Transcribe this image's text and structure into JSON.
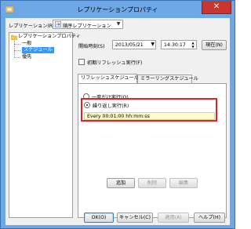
{
  "window": {
    "title": "レプリケーションプロパティ",
    "close_glyph": "✕"
  },
  "replication": {
    "label": "レプリケーション(R)",
    "selected": "順序レプリケーション"
  },
  "tree": {
    "root": "レプリケーションプロパティ",
    "items": [
      "一般",
      "スケジュール",
      "優先"
    ],
    "selected_index": 1
  },
  "schedule": {
    "start_label": "開始時刻(S)",
    "date": "2013/05/21",
    "time": "14:30:17",
    "now_button": "現在(N)",
    "initial_refresh_label": "初期リフレッシュ実行(F)",
    "initial_refresh_checked": false
  },
  "tabs": [
    {
      "label": "リフレッシュスケジュール",
      "active": true
    },
    {
      "label": "ミラーリングスケジュール",
      "active": false
    }
  ],
  "refresh": {
    "once_label": "一度だけ実行(O)",
    "once_selected": false,
    "repeat_label": "繰り返し実行(R)",
    "repeat_selected": true,
    "recurrence_text": "Every 00:01:00 hh:mm:ss",
    "add_button": "追加",
    "delete_button": "削除",
    "edit_button": "編集"
  },
  "footer": {
    "ok": "OK(O)",
    "cancel": "キャンセル(C)",
    "apply": "適用(A)",
    "help": "ヘルプ(H)"
  },
  "colors": {
    "titlebar": "#6ea7e6",
    "close": "#c7372f",
    "highlight_border": "#e0202a",
    "recurrence_bg": "#fffacd",
    "selection": "#3399ff"
  }
}
